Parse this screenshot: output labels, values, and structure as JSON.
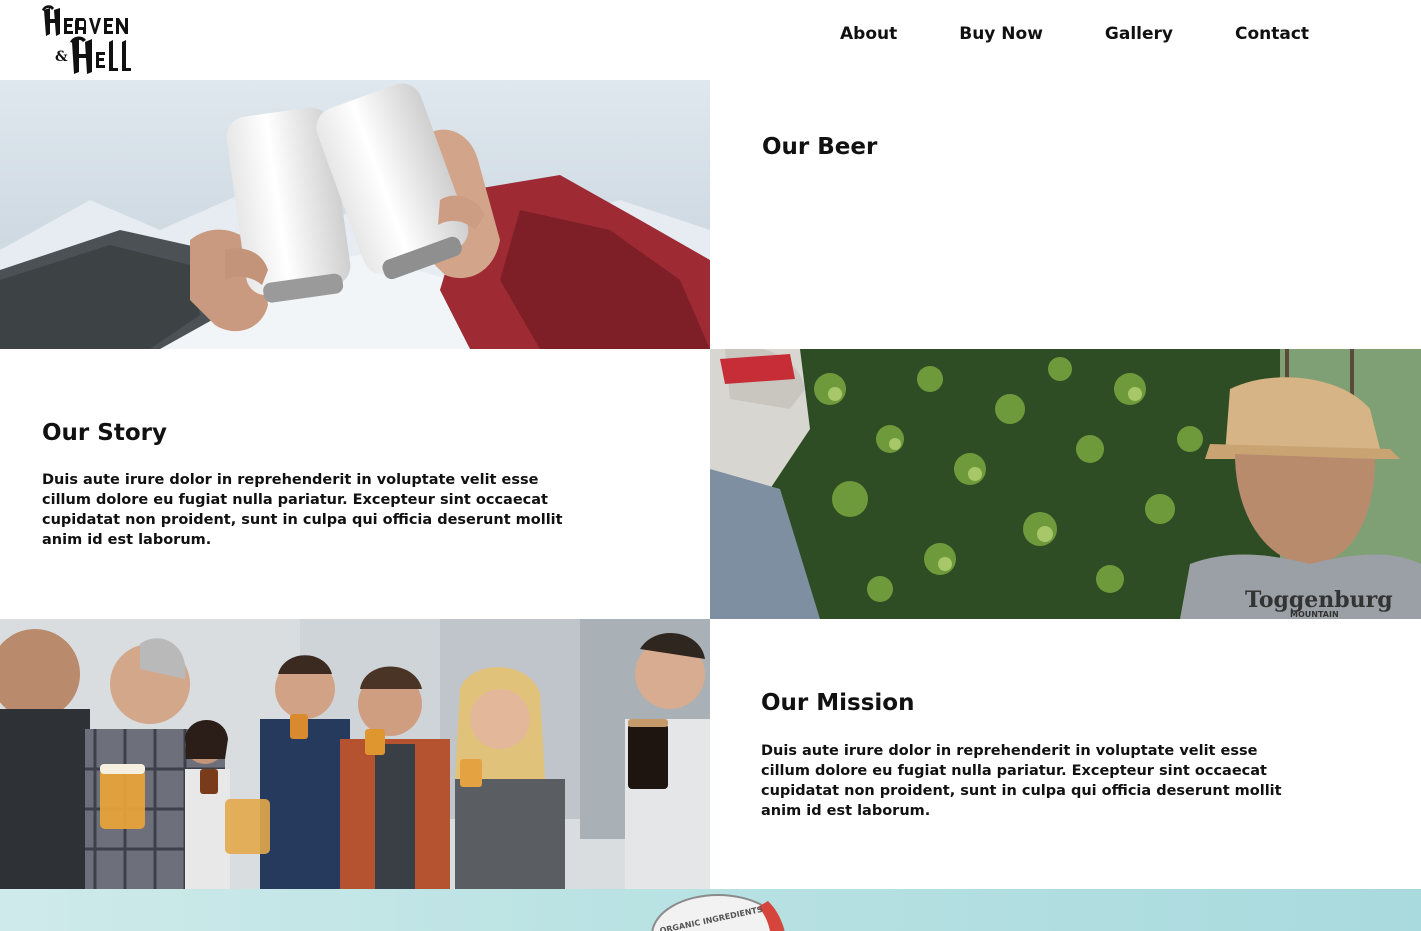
{
  "brand": {
    "logo_alt": "Heaven & Hell"
  },
  "nav": {
    "items": [
      {
        "label": "About"
      },
      {
        "label": "Buy Now"
      },
      {
        "label": "Gallery"
      },
      {
        "label": "Contact"
      }
    ]
  },
  "sections": {
    "beer": {
      "title": "Our Beer",
      "body": ""
    },
    "story": {
      "title": "Our Story",
      "body": "Duis aute irure dolor in reprehenderit in voluptate velit esse cillum dolore eu fugiat nulla pariatur. Excepteur sint occaecat cupidatat non proident, sunt in culpa qui officia deserunt mollit anim id est laborum."
    },
    "mission": {
      "title": "Our Mission",
      "body": "Duis aute irure dolor in reprehenderit in voluptate velit esse cillum dolore eu fugiat nulla pariatur. Excepteur sint occaecat cupidatat non proident, sunt in culpa qui officia deserunt mollit anim id est laborum."
    }
  },
  "photos": {
    "cans": {
      "description": "two hands toasting white cans"
    },
    "hops": {
      "description": "people inspecting hop plants",
      "shirt_text": "Toggenburg",
      "shirt_subtext": "MOUNTAIN"
    },
    "tasting": {
      "description": "group tasting beer"
    }
  },
  "bottom": {
    "badge_text": "ORGANIC INGREDIENTS"
  },
  "colors": {
    "text": "#111111",
    "background": "#ffffff",
    "band": "#b9e2e3"
  }
}
